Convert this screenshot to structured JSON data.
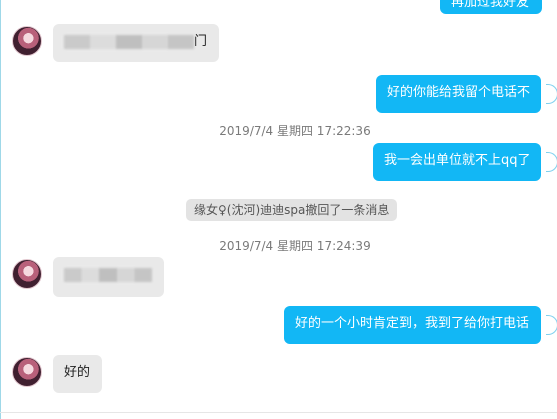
{
  "messages": {
    "top_partial_text": "再加过我好友",
    "msg1_suffix": "门",
    "msg2": "好的你能给我留个电话不",
    "time1": "2019/7/4 星期四 17:22:36",
    "msg3": "我一会出单位就不上qq了",
    "recall_notice": "缘女♀(沈河)迪迪spa撤回了一条消息",
    "time2": "2019/7/4 星期四 17:24:39",
    "msg5": "好的一个小时肯定到，我到了给你打电话",
    "msg6": "好的"
  },
  "colors": {
    "outgoing_bubble": "#12b7f5",
    "incoming_bubble": "#e9e9e9",
    "timestamp_text": "#7a7a7a"
  },
  "icons": {
    "avatar": "user-avatar",
    "read_status": "read-status-icon"
  }
}
